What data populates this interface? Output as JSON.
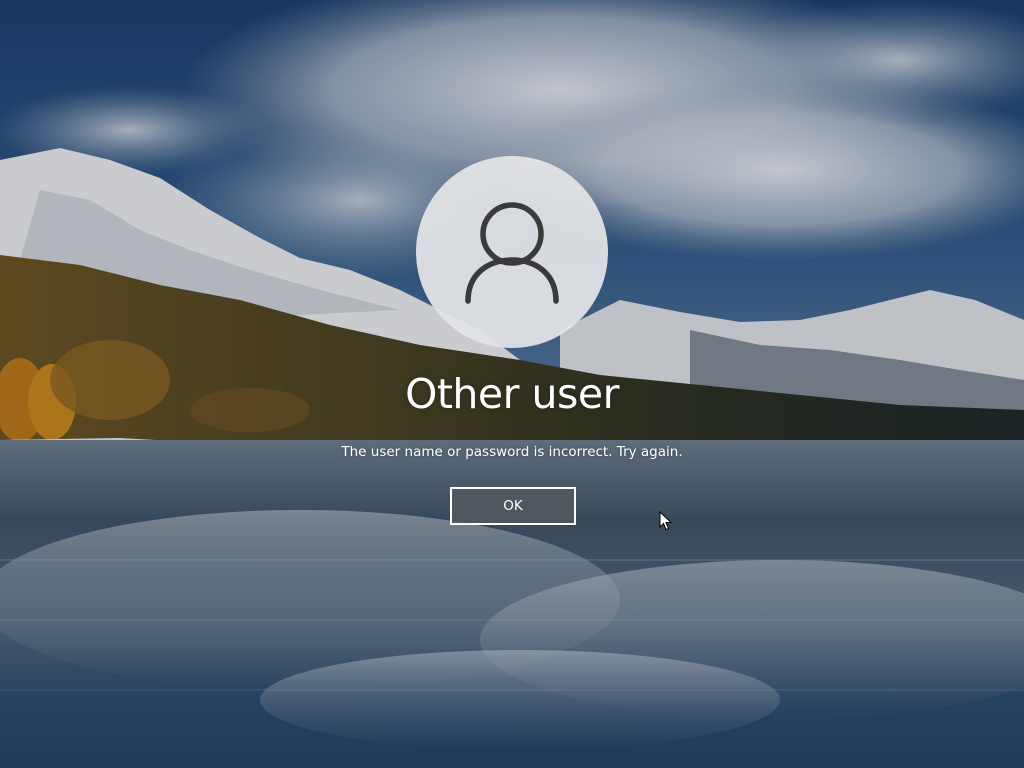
{
  "lock_screen": {
    "background": "lake-and-snowy-mountains-wallpaper",
    "user": {
      "avatar_icon": "user-silhouette-icon",
      "name": "Other user"
    },
    "error_message": "The user name or password is incorrect. Try again.",
    "ok_button_label": "OK",
    "pointer_icon": "mouse-pointer-icon"
  },
  "colors": {
    "button_fill": "#55595e",
    "button_border": "#ffffff",
    "avatar_fill": "#e2e3e5",
    "avatar_glyph": "#3a3a3a",
    "text": "#ffffff"
  }
}
